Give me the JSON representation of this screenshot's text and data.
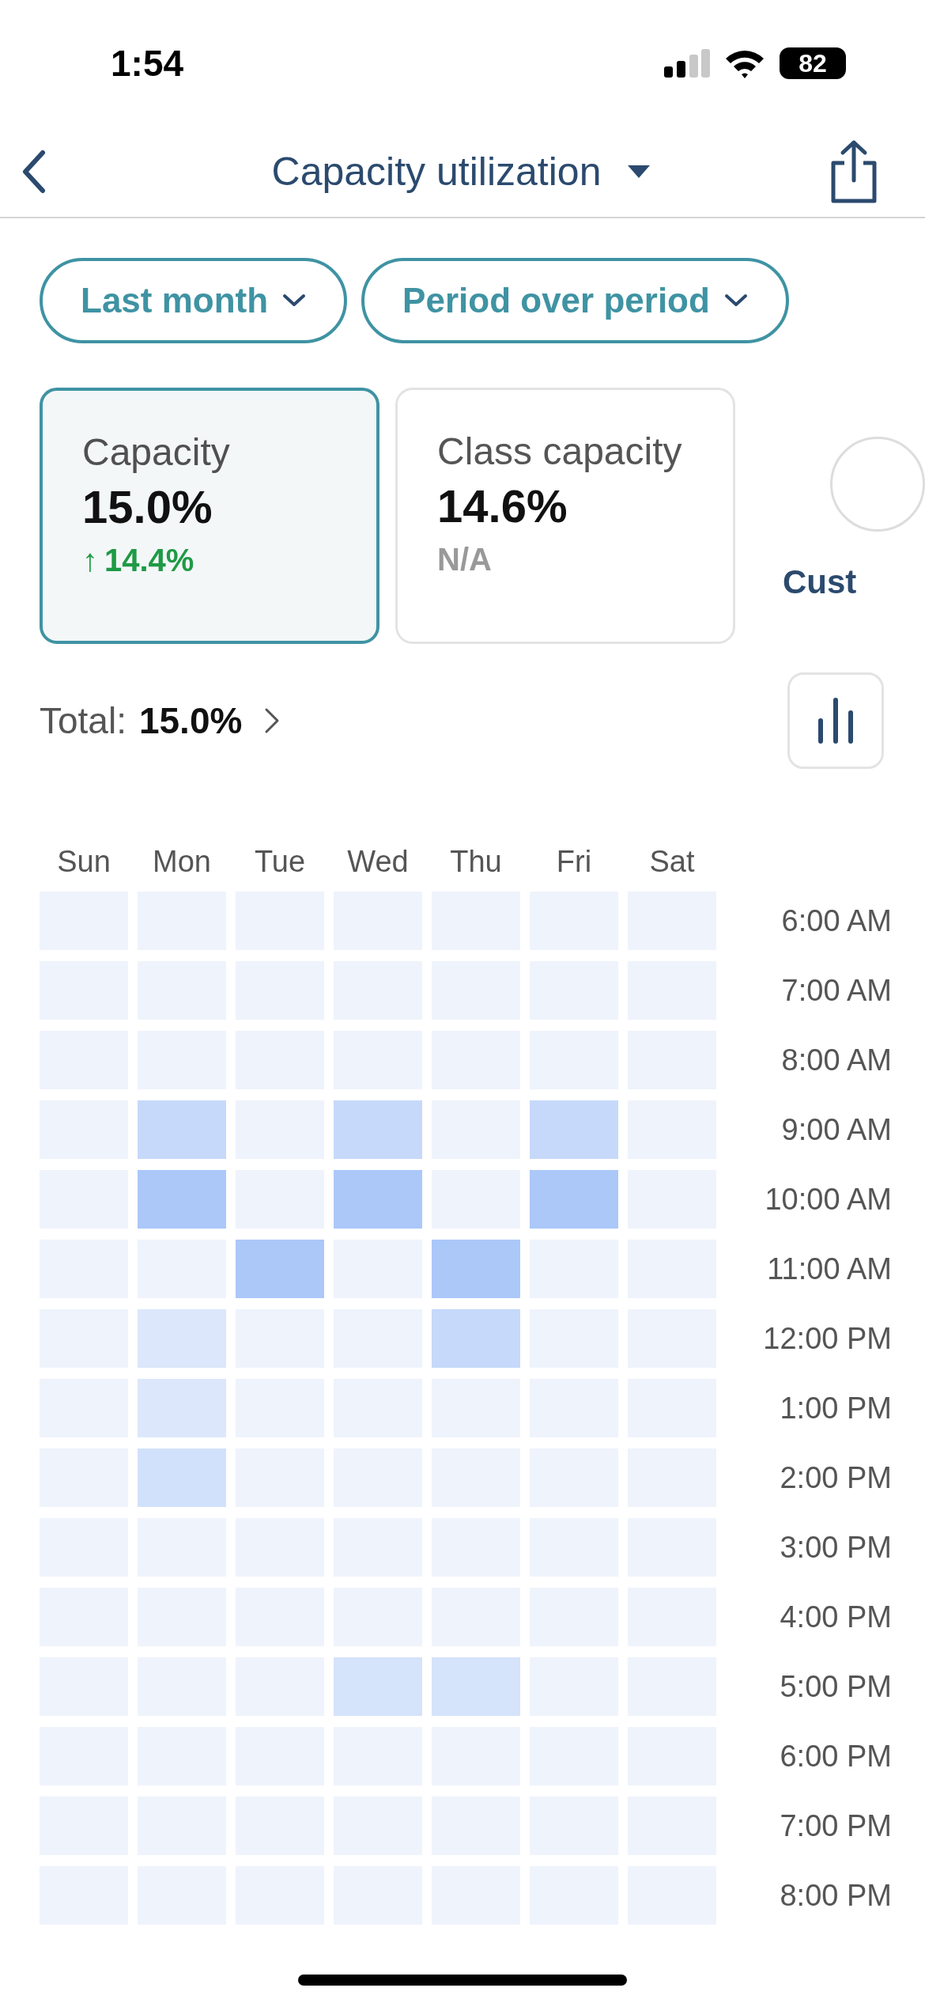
{
  "status_bar": {
    "time": "1:54",
    "battery": "82"
  },
  "nav": {
    "title": "Capacity utilization"
  },
  "filters": [
    {
      "label": "Last month"
    },
    {
      "label": "Period over period"
    }
  ],
  "cards": [
    {
      "kind": "metric",
      "selected": true,
      "label": "Capacity",
      "value": "15.0%",
      "change_arrow": "↑",
      "change": "14.4%"
    },
    {
      "kind": "metric",
      "selected": false,
      "label": "Class capacity",
      "value": "14.6%",
      "change": "N/A"
    },
    {
      "kind": "link",
      "label": "Cust"
    }
  ],
  "total": {
    "label": "Total:",
    "value": "15.0%"
  },
  "heatmap": {
    "days": [
      "Sun",
      "Mon",
      "Tue",
      "Wed",
      "Thu",
      "Fri",
      "Sat"
    ],
    "rows": [
      {
        "time": "6:00 AM",
        "cells": [
          {
            "color": "#eff3fc"
          },
          {
            "color": "#eff3fc"
          },
          {
            "color": "#eff3fc"
          },
          {
            "color": "#eff3fc"
          },
          {
            "color": "#eff3fc"
          },
          {
            "color": "#eff3fc"
          },
          {
            "color": "#eff3fc"
          }
        ]
      },
      {
        "time": "7:00 AM",
        "cells": [
          {
            "color": "#eff3fc"
          },
          {
            "color": "#eff3fc"
          },
          {
            "color": "#eff3fc"
          },
          {
            "color": "#eff3fc"
          },
          {
            "color": "#eff3fc"
          },
          {
            "color": "#eff3fc"
          },
          {
            "color": "#eff3fc"
          }
        ]
      },
      {
        "time": "8:00 AM",
        "cells": [
          {
            "color": "#eff3fc"
          },
          {
            "color": "#eff3fc"
          },
          {
            "color": "#eff3fc"
          },
          {
            "color": "#eff3fc"
          },
          {
            "color": "#eff3fc"
          },
          {
            "color": "#eff3fc"
          },
          {
            "color": "#eff3fc"
          }
        ]
      },
      {
        "time": "9:00 AM",
        "cells": [
          {
            "color": "#eff3fc"
          },
          {
            "color": "#c6d9fa"
          },
          {
            "color": "#eff3fc"
          },
          {
            "color": "#c6d9fa"
          },
          {
            "color": "#eff3fc"
          },
          {
            "color": "#c6d9fa"
          },
          {
            "color": "#eff3fc"
          }
        ]
      },
      {
        "time": "10:00 AM",
        "cells": [
          {
            "color": "#eff3fc"
          },
          {
            "color": "#abc8f9"
          },
          {
            "color": "#eff3fc"
          },
          {
            "color": "#abc8f9"
          },
          {
            "color": "#eff3fc"
          },
          {
            "color": "#abc8f9"
          },
          {
            "color": "#eff3fc"
          }
        ]
      },
      {
        "time": "11:00 AM",
        "cells": [
          {
            "color": "#eff3fc"
          },
          {
            "color": "#eff3fc"
          },
          {
            "color": "#abc8f9"
          },
          {
            "color": "#eff3fc"
          },
          {
            "color": "#abc8f9"
          },
          {
            "color": "#eff3fc"
          },
          {
            "color": "#eff3fc"
          }
        ]
      },
      {
        "time": "12:00 PM",
        "cells": [
          {
            "color": "#eff3fc"
          },
          {
            "color": "#dce7fb"
          },
          {
            "color": "#eff3fc"
          },
          {
            "color": "#eff3fc"
          },
          {
            "color": "#c6d9fa"
          },
          {
            "color": "#eff3fc"
          },
          {
            "color": "#eff3fc"
          }
        ]
      },
      {
        "time": "1:00 PM",
        "cells": [
          {
            "color": "#eff3fc"
          },
          {
            "color": "#dce7fb"
          },
          {
            "color": "#eff3fc"
          },
          {
            "color": "#eff3fc"
          },
          {
            "color": "#eff3fc"
          },
          {
            "color": "#eff3fc"
          },
          {
            "color": "#eff3fc"
          }
        ]
      },
      {
        "time": "2:00 PM",
        "cells": [
          {
            "color": "#eff3fc"
          },
          {
            "color": "#d2e1fb"
          },
          {
            "color": "#eff3fc"
          },
          {
            "color": "#eff3fc"
          },
          {
            "color": "#eff3fc"
          },
          {
            "color": "#eff3fc"
          },
          {
            "color": "#eff3fc"
          }
        ]
      },
      {
        "time": "3:00 PM",
        "cells": [
          {
            "color": "#eff3fc"
          },
          {
            "color": "#eff3fc"
          },
          {
            "color": "#eff3fc"
          },
          {
            "color": "#eff3fc"
          },
          {
            "color": "#eff3fc"
          },
          {
            "color": "#eff3fc"
          },
          {
            "color": "#eff3fc"
          }
        ]
      },
      {
        "time": "4:00 PM",
        "cells": [
          {
            "color": "#eff3fc"
          },
          {
            "color": "#eff3fc"
          },
          {
            "color": "#eff3fc"
          },
          {
            "color": "#eff3fc"
          },
          {
            "color": "#eff3fc"
          },
          {
            "color": "#eff3fc"
          },
          {
            "color": "#eff3fc"
          }
        ]
      },
      {
        "time": "5:00 PM",
        "cells": [
          {
            "color": "#eff3fc"
          },
          {
            "color": "#eff3fc"
          },
          {
            "color": "#eff3fc"
          },
          {
            "color": "#d5e3fb"
          },
          {
            "color": "#d5e3fb"
          },
          {
            "color": "#eff3fc"
          },
          {
            "color": "#eff3fc"
          }
        ]
      },
      {
        "time": "6:00 PM",
        "cells": [
          {
            "color": "#eff3fc"
          },
          {
            "color": "#eff3fc"
          },
          {
            "color": "#eff3fc"
          },
          {
            "color": "#eff3fc"
          },
          {
            "color": "#eff3fc"
          },
          {
            "color": "#eff3fc"
          },
          {
            "color": "#eff3fc"
          }
        ]
      },
      {
        "time": "7:00 PM",
        "cells": [
          {
            "color": "#eff3fc"
          },
          {
            "color": "#eff3fc"
          },
          {
            "color": "#eff3fc"
          },
          {
            "color": "#eff3fc"
          },
          {
            "color": "#eff3fc"
          },
          {
            "color": "#eff3fc"
          },
          {
            "color": "#eff3fc"
          }
        ]
      },
      {
        "time": "8:00 PM",
        "cells": [
          {
            "color": "#eff3fc"
          },
          {
            "color": "#eff3fc"
          },
          {
            "color": "#eff3fc"
          },
          {
            "color": "#eff3fc"
          },
          {
            "color": "#eff3fc"
          },
          {
            "color": "#eff3fc"
          },
          {
            "color": "#eff3fc"
          }
        ]
      }
    ]
  }
}
